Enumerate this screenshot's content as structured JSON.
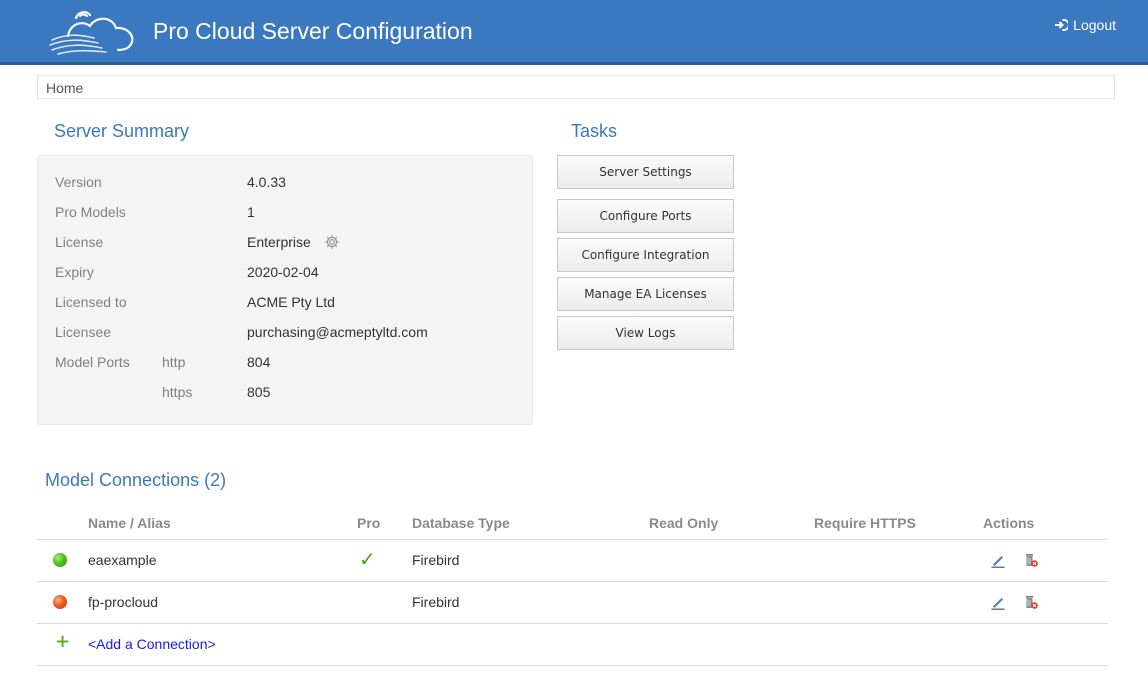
{
  "header": {
    "title": "Pro Cloud Server Configuration",
    "logout_label": "Logout",
    "logo_icon": "cloud-logo-icon",
    "logout_icon": "logout-arrow-icon",
    "background_color": "#3a78bf"
  },
  "breadcrumb": {
    "home": "Home"
  },
  "summary": {
    "title": "Server Summary",
    "rows": [
      {
        "label": "Version",
        "value": "4.0.33"
      },
      {
        "label": "Pro Models",
        "value": "1"
      },
      {
        "label": "License",
        "value": "Enterprise"
      },
      {
        "label": "Expiry",
        "value": "2020-02-04"
      },
      {
        "label": "Licensed to",
        "value": "ACME Pty Ltd"
      },
      {
        "label": "Licensee",
        "value": "purchasing@acmeptyltd.com"
      }
    ],
    "ports": {
      "label": "Model Ports",
      "http_label": "http",
      "http_value": "804",
      "https_label": "https",
      "https_value": "805"
    }
  },
  "tasks": {
    "title": "Tasks",
    "buttons": [
      "Server Settings",
      "Configure Ports",
      "Configure Integration",
      "Manage EA Licenses",
      "View Logs"
    ]
  },
  "connections": {
    "title": "Model Connections (2)",
    "columns": [
      "Name / Alias",
      "Pro",
      "Database Type",
      "Read Only",
      "Require HTTPS",
      "Actions"
    ],
    "rows": [
      {
        "name": "eaexample",
        "status": "green",
        "pro": true,
        "db_type": "Firebird"
      },
      {
        "name": "fp-procloud",
        "status": "red",
        "pro": false,
        "db_type": "Firebird"
      }
    ],
    "add_label": "<Add a Connection>"
  }
}
